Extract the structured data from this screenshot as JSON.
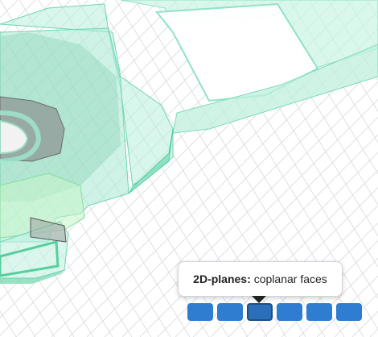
{
  "tooltip": {
    "title": "2D-planes:",
    "description": "coplanar faces"
  },
  "toolbar": {
    "buttons": [
      {
        "name": "view-button-1",
        "active": false
      },
      {
        "name": "view-button-2",
        "active": false
      },
      {
        "name": "view-button-2d-planes",
        "active": true
      },
      {
        "name": "view-button-4",
        "active": false
      },
      {
        "name": "view-button-5",
        "active": false
      },
      {
        "name": "view-button-6",
        "active": false
      }
    ]
  },
  "colors": {
    "background": "#ffffff",
    "grid": "#dde0e4",
    "model_face": "#9fe8cf",
    "model_edge": "#5cd6a8",
    "gray_part": "#9a9a9a",
    "button": "#2f7dd1",
    "button_active": "#2a6fb8"
  }
}
